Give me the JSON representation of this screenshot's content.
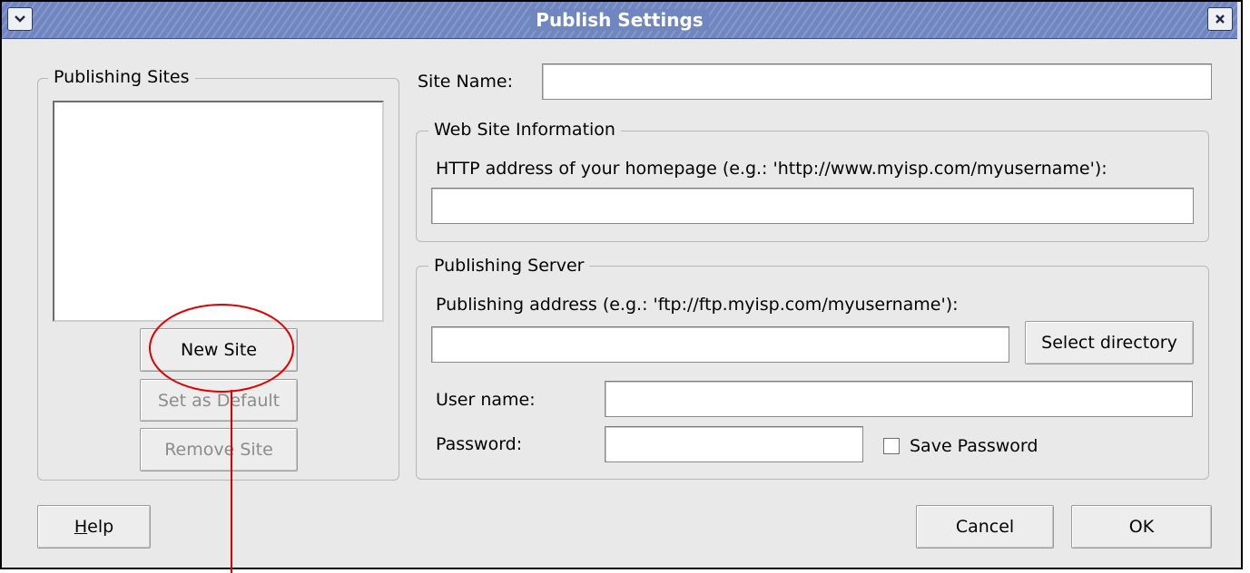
{
  "window": {
    "title": "Publish Settings",
    "menu_icon": "chevron-down-icon",
    "close_icon": "close-icon"
  },
  "sites_panel": {
    "legend": "Publishing Sites",
    "sites": [],
    "new_site": "New Site",
    "set_default": "Set as Default",
    "remove_site": "Remove Site"
  },
  "site_name": {
    "label": "Site Name:",
    "value": ""
  },
  "web_info": {
    "legend": "Web Site Information",
    "http_label": "HTTP address of your homepage (e.g.: 'http://www.myisp.com/myusername'):",
    "http_value": ""
  },
  "server": {
    "legend": "Publishing Server",
    "address_label": "Publishing address (e.g.: 'ftp://ftp.myisp.com/myusername'):",
    "address_value": "",
    "select_dir": "Select directory",
    "user_label": "User name:",
    "user_value": "",
    "password_label": "Password:",
    "password_value": "",
    "save_password_label": "Save Password",
    "save_password_checked": false
  },
  "footer": {
    "help_mnemonic": "H",
    "help_rest": "elp",
    "cancel": "Cancel",
    "ok": "OK"
  },
  "colors": {
    "titlebar": "#6f86c0",
    "dialog_bg": "#e9e9e9",
    "annotation": "#e00000"
  }
}
